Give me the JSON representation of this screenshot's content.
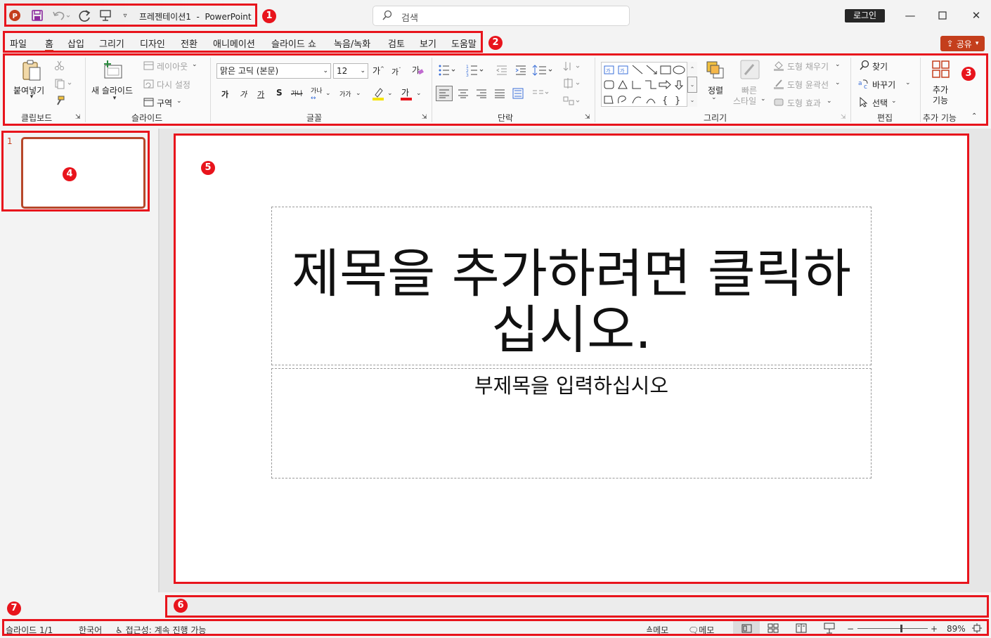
{
  "app": {
    "doc_title": "프레젠테이션1",
    "separator": "-",
    "app_name": "PowerPoint"
  },
  "search": {
    "placeholder": "검색"
  },
  "account": {
    "login_label": "로그인"
  },
  "menu": {
    "tabs": [
      "파일",
      "홈",
      "삽입",
      "그리기",
      "디자인",
      "전환",
      "애니메이션",
      "슬라이드 쇼",
      "녹음/녹화",
      "검토",
      "보기",
      "도움말"
    ],
    "active_tab": "홈",
    "share_label": "공유"
  },
  "ribbon": {
    "clipboard": {
      "paste_label": "붙여넣기",
      "group_label": "클립보드"
    },
    "slides": {
      "new_slide_label": "새 슬라이드",
      "layout_label": "레이아웃",
      "reset_label": "다시 설정",
      "section_label": "구역",
      "group_label": "슬라이드"
    },
    "font": {
      "font_name": "맑은 고딕 (본문)",
      "font_size": "12",
      "group_label": "글꼴",
      "bold": "가",
      "italic": "가",
      "underline": "가",
      "shadow": "S",
      "strike": "가나",
      "spacing": "가나",
      "case": "가가",
      "grow": "가",
      "shrink": "가",
      "color_glyph": "가"
    },
    "paragraph": {
      "group_label": "단락"
    },
    "drawing": {
      "arrange_label": "정렬",
      "quick_styles_label_1": "빠른",
      "quick_styles_label_2": "스타일",
      "fill_label": "도형 채우기",
      "outline_label": "도형 윤곽선",
      "effects_label": "도형 효과",
      "group_label": "그리기"
    },
    "editing": {
      "find_label": "찾기",
      "replace_label": "바꾸기",
      "select_label": "선택",
      "group_label": "편집"
    },
    "addins": {
      "label_1": "추가",
      "label_2": "기능",
      "group_label": "추가 기능"
    }
  },
  "slide_pane": {
    "slide_number": "1"
  },
  "slide": {
    "title_placeholder": "제목을 추가하려면 클릭하십시오.",
    "subtitle_placeholder": "부제목을 입력하십시오"
  },
  "status_bar": {
    "slide_info": "슬라이드 1/1",
    "language": "한국어",
    "accessibility": "접근성: 계속 진행 가능",
    "notes_label": "메모",
    "comments_label": "메모",
    "zoom_level": "89%",
    "zoom_minus": "−",
    "zoom_plus": "+",
    "zoom_fraction": 0.62
  },
  "annotations": [
    "1",
    "2",
    "3",
    "4",
    "5",
    "6",
    "7"
  ],
  "colors": {
    "accent": "#c43e1c",
    "highlight_box": "#e8141c",
    "thumb_border": "#b7472a"
  }
}
